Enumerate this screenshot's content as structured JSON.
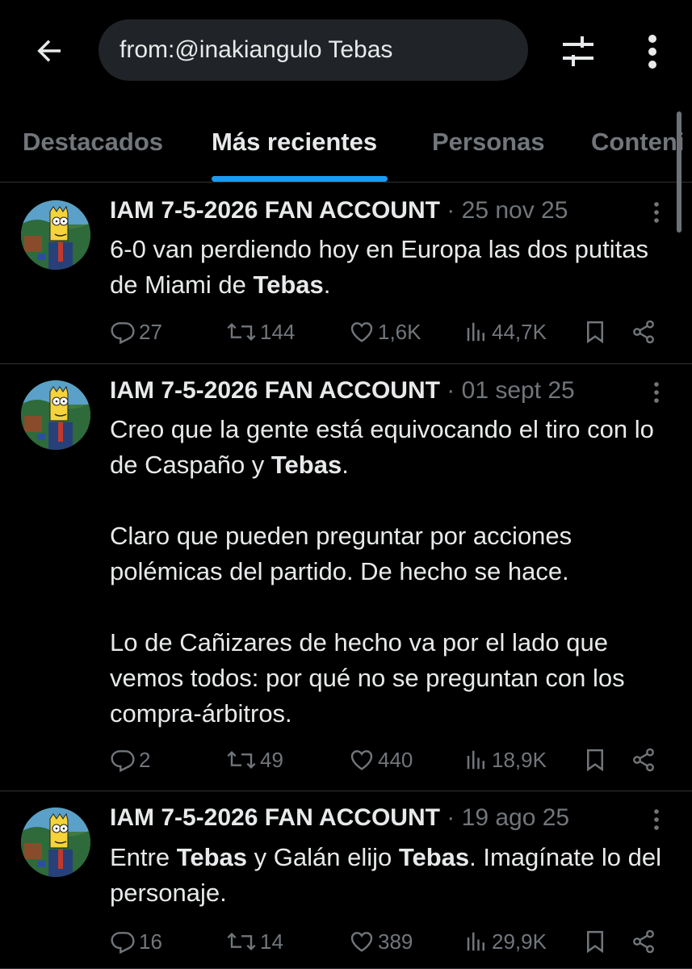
{
  "search": {
    "query": "from:@inakiangulo Tebas"
  },
  "tabs": [
    {
      "label": "Destacados"
    },
    {
      "label": "Más recientes"
    },
    {
      "label": "Personas"
    },
    {
      "label": "Conteni"
    }
  ],
  "active_tab": "Más recientes",
  "tweets": [
    {
      "name": "IAM 7-5-2026 FAN ACCOUNT",
      "date": "25 nov 25",
      "text": [
        [
          {
            "t": "6-0 van perdiendo hoy en Europa las dos putitas de Miami de "
          },
          {
            "t": "Tebas",
            "b": true
          },
          {
            "t": "."
          }
        ]
      ],
      "replies": "27",
      "retweets": "144",
      "likes": "1,6K",
      "views": "44,7K"
    },
    {
      "name": "IAM 7-5-2026 FAN ACCOUNT",
      "date": "01 sept 25",
      "text": [
        [
          {
            "t": "Creo que la gente está equivocando el tiro con lo de Caspaño y "
          },
          {
            "t": "Tebas",
            "b": true
          },
          {
            "t": "."
          }
        ],
        [
          {
            "t": "Claro que pueden preguntar por acciones polémicas del partido. De hecho se hace."
          }
        ],
        [
          {
            "t": "Lo de Cañizares de hecho va por el lado que vemos todos: por qué no se preguntan con los compra-árbitros."
          }
        ]
      ],
      "replies": "2",
      "retweets": "49",
      "likes": "440",
      "views": "18,9K"
    },
    {
      "name": "IAM 7-5-2026 FAN ACCOUNT",
      "date": "19 ago 25",
      "text": [
        [
          {
            "t": "Entre "
          },
          {
            "t": "Tebas",
            "b": true
          },
          {
            "t": " y Galán elijo "
          },
          {
            "t": "Tebas",
            "b": true
          },
          {
            "t": ". Imagínate lo del personaje."
          }
        ]
      ],
      "replies": "16",
      "retweets": "14",
      "likes": "389",
      "views": "29,9K"
    }
  ],
  "colors": {
    "background": "#000000",
    "text": "#e7e9ea",
    "muted": "#71767b",
    "accent": "#1d9bf0",
    "divider": "#2f3336",
    "search_bg": "#202327"
  },
  "icons": {
    "back": "arrow-left-icon",
    "filter": "sliders-icon",
    "more": "more-vertical-icon",
    "reply": "reply-icon",
    "retweet": "retweet-icon",
    "like": "heart-icon",
    "views": "views-chart-icon",
    "bookmark": "bookmark-icon",
    "share": "share-icon"
  }
}
